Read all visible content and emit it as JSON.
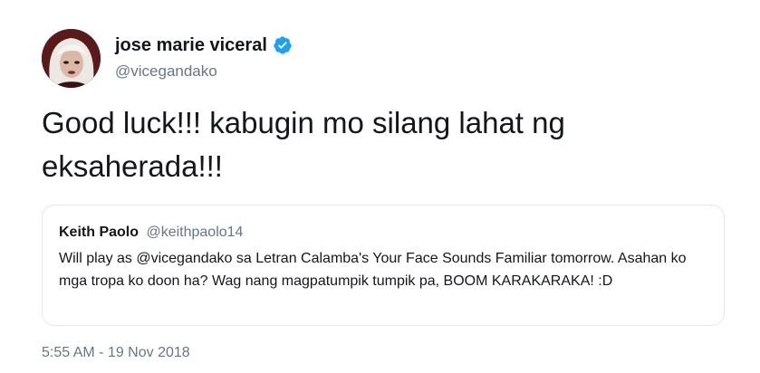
{
  "author": {
    "display_name": "jose marie viceral",
    "handle": "@vicegandako",
    "verified_icon": "verified-badge-icon",
    "avatar_icon": "profile-avatar"
  },
  "tweet": {
    "text": "Good luck!!! kabugin mo silang lahat ng eksaherada!!!"
  },
  "quoted_tweet": {
    "display_name": "Keith Paolo",
    "handle": "@keithpaolo14",
    "text": "Will play as @vicegandako sa Letran Calamba's Your Face Sounds Familiar tomorrow. Asahan ko mga tropa ko doon ha? Wag nang magpatumpik tumpik pa, BOOM KARAKARAKA! :D"
  },
  "timestamp": "5:55 AM - 19 Nov 2018",
  "colors": {
    "text": "#14171a",
    "secondary_text": "#657786",
    "verified_blue": "#1da1f2",
    "border": "#e1e8ed"
  }
}
